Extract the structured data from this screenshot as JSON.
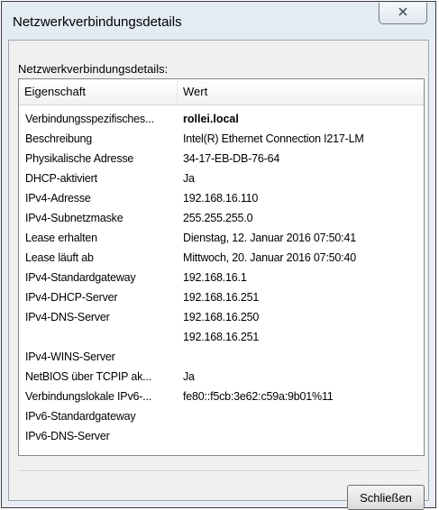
{
  "window": {
    "title": "Netzwerkverbindungsdetails"
  },
  "group_label": "Netzwerkverbindungsdetails:",
  "table": {
    "columns": [
      "Eigenschaft",
      "Wert"
    ],
    "rows": [
      {
        "prop": "Verbindungsspezifisches...",
        "val": "rollei.local"
      },
      {
        "prop": "Beschreibung",
        "val": "Intel(R) Ethernet Connection I217-LM"
      },
      {
        "prop": "Physikalische Adresse",
        "val": "34-17-EB-DB-76-64"
      },
      {
        "prop": "DHCP-aktiviert",
        "val": "Ja"
      },
      {
        "prop": "IPv4-Adresse",
        "val": "192.168.16.110"
      },
      {
        "prop": "IPv4-Subnetzmaske",
        "val": "255.255.255.0"
      },
      {
        "prop": "Lease erhalten",
        "val": "Dienstag, 12. Januar 2016 07:50:41"
      },
      {
        "prop": "Lease läuft ab",
        "val": "Mittwoch, 20. Januar 2016 07:50:40"
      },
      {
        "prop": "IPv4-Standardgateway",
        "val": "192.168.16.1"
      },
      {
        "prop": "IPv4-DHCP-Server",
        "val": "192.168.16.251"
      },
      {
        "prop": "IPv4-DNS-Server",
        "val": "192.168.16.250"
      },
      {
        "prop": "",
        "val": "192.168.16.251"
      },
      {
        "prop": "IPv4-WINS-Server",
        "val": ""
      },
      {
        "prop": "NetBIOS über TCPIP ak...",
        "val": "Ja"
      },
      {
        "prop": "Verbindungslokale IPv6-...",
        "val": "fe80::f5cb:3e62:c59a:9b01%11"
      },
      {
        "prop": "IPv6-Standardgateway",
        "val": ""
      },
      {
        "prop": "IPv6-DNS-Server",
        "val": ""
      }
    ]
  },
  "buttons": {
    "close_label": "Schließen"
  },
  "icons": {
    "window_close": "close-icon"
  }
}
